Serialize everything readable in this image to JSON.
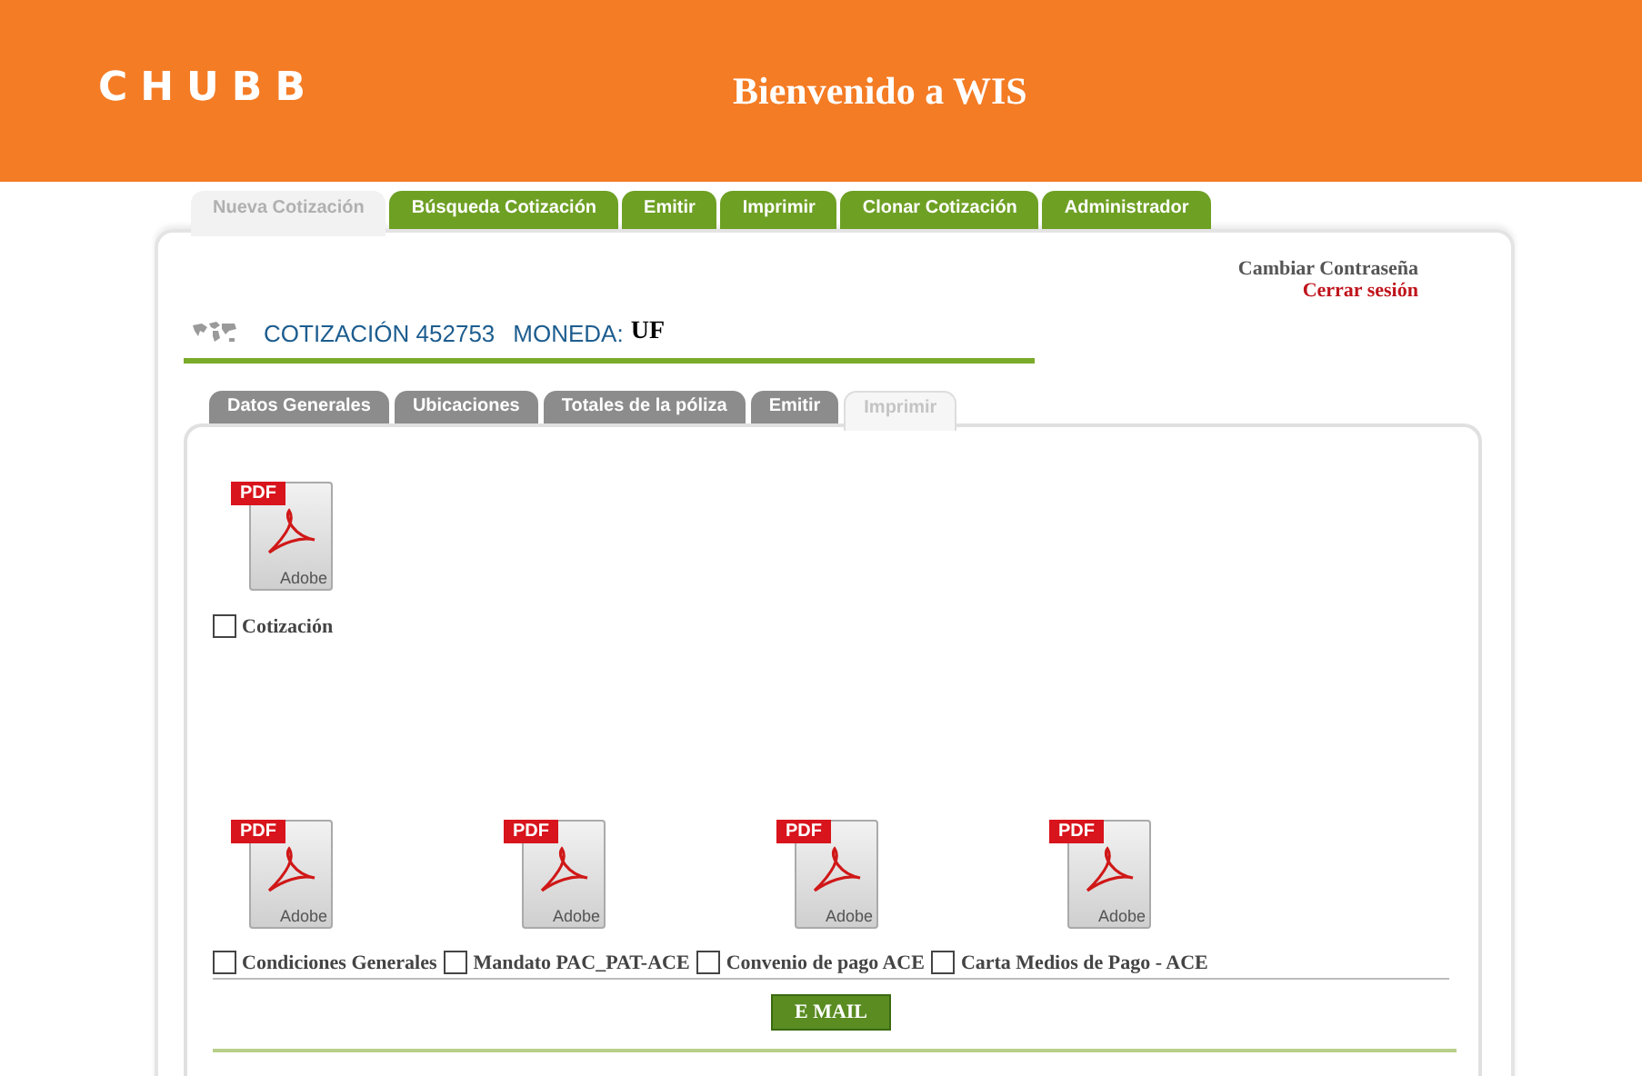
{
  "header": {
    "logo": "CHUBB",
    "title": "Bienvenido a WIS"
  },
  "main_tabs": [
    {
      "label": "Nueva Cotización",
      "selected": true
    },
    {
      "label": "Búsqueda Cotización",
      "selected": false
    },
    {
      "label": "Emitir",
      "selected": false
    },
    {
      "label": "Imprimir",
      "selected": false
    },
    {
      "label": "Clonar Cotización",
      "selected": false
    },
    {
      "label": "Administrador",
      "selected": false
    }
  ],
  "account_links": [
    "Cambiar Contraseña",
    "Cerrar sesión"
  ],
  "quote": {
    "label": "COTIZACIÓN 452753",
    "currency_label": "MONEDA:",
    "currency": "UF"
  },
  "sub_tabs": [
    {
      "label": "Datos Generales",
      "selected": false
    },
    {
      "label": "Ubicaciones",
      "selected": false
    },
    {
      "label": "Totales de la póliza",
      "selected": false
    },
    {
      "label": "Emitir",
      "selected": false
    },
    {
      "label": "Imprimir",
      "selected": true
    }
  ],
  "main_document": {
    "badge": "PDF",
    "brand": "Adobe",
    "label": "Cotización",
    "checked": false
  },
  "documents": [
    {
      "badge": "PDF",
      "brand": "Adobe",
      "label": "Condiciones Generales",
      "checked": false
    },
    {
      "badge": "PDF",
      "brand": "Adobe",
      "label": "Mandato PAC_PAT-ACE",
      "checked": false
    },
    {
      "badge": "PDF",
      "brand": "Adobe",
      "label": "Convenio de pago ACE",
      "checked": false
    },
    {
      "badge": "PDF",
      "brand": "Adobe",
      "label": "Carta Medios de Pago - ACE",
      "checked": false
    }
  ],
  "email_button": "E MAIL"
}
